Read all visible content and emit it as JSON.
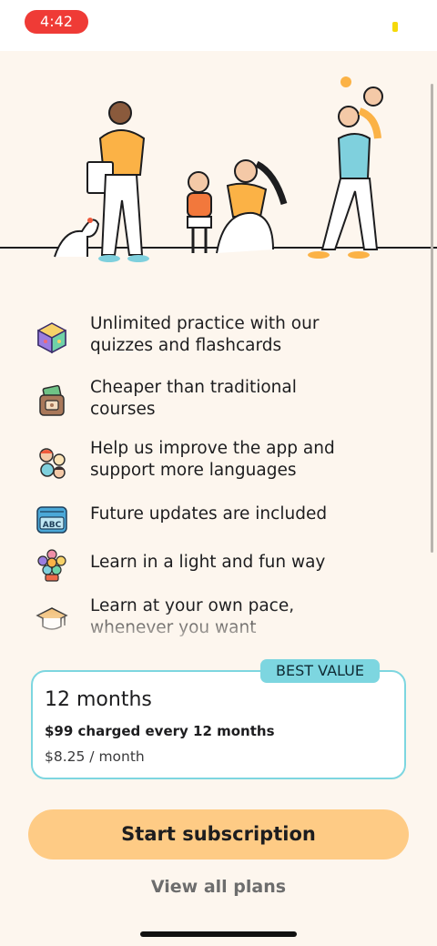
{
  "status": {
    "time": "4:42"
  },
  "colors": {
    "accent": "#fecb85",
    "badge": "#7dd6e0",
    "background": "#fdf6ee",
    "time_pill": "#ef3b36"
  },
  "hero": {
    "image": "family-learning-illustration"
  },
  "features": [
    {
      "icon": "cube-icon",
      "text": "Unlimited practice with our quizzes and flashcards"
    },
    {
      "icon": "wallet-icon",
      "text": "Cheaper than traditional courses"
    },
    {
      "icon": "community-icon",
      "text": "Help us improve the app and support more languages"
    },
    {
      "icon": "abc-book-icon",
      "text": "Future updates are included"
    },
    {
      "icon": "flower-icon",
      "text": "Learn in a light and fun way"
    },
    {
      "icon": "graduation-cap-icon",
      "text": "Learn at your own pace, whenever you want"
    }
  ],
  "plan": {
    "badge": "BEST VALUE",
    "title": "12 months",
    "charge": "$99 charged every 12 months",
    "monthly": "$8.25 / month"
  },
  "actions": {
    "start": "Start subscription",
    "view_all": "View all plans"
  }
}
